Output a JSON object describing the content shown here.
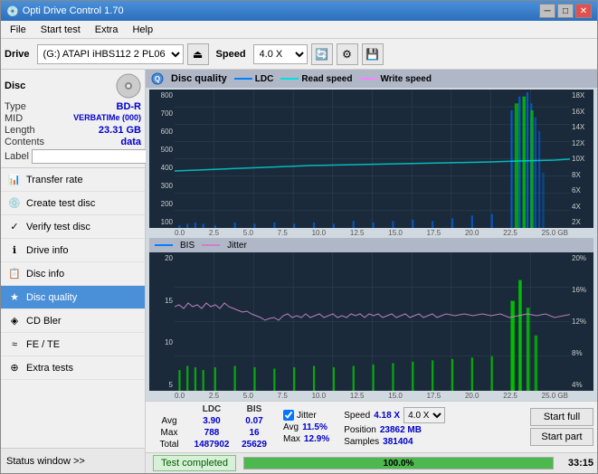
{
  "window": {
    "title": "Opti Drive Control 1.70",
    "minimize": "─",
    "maximize": "□",
    "close": "✕"
  },
  "menubar": {
    "items": [
      "File",
      "Start test",
      "Extra",
      "Help"
    ]
  },
  "toolbar": {
    "drive_label": "Drive",
    "drive_value": "(G:) ATAPI iHBS112 2 PL06",
    "eject_icon": "⏏",
    "speed_label": "Speed",
    "speed_value": "4.0 X"
  },
  "sidebar": {
    "disc_section": {
      "title": "Disc",
      "type_label": "Type",
      "type_value": "BD-R",
      "mid_label": "MID",
      "mid_value": "VERBATIMe (000)",
      "length_label": "Length",
      "length_value": "23.31 GB",
      "contents_label": "Contents",
      "contents_value": "data",
      "label_label": "Label"
    },
    "nav_items": [
      {
        "id": "transfer-rate",
        "label": "Transfer rate",
        "icon": "📊"
      },
      {
        "id": "create-test-disc",
        "label": "Create test disc",
        "icon": "💿"
      },
      {
        "id": "verify-test-disc",
        "label": "Verify test disc",
        "icon": "✓"
      },
      {
        "id": "drive-info",
        "label": "Drive info",
        "icon": "ℹ"
      },
      {
        "id": "disc-info",
        "label": "Disc info",
        "icon": "📋"
      },
      {
        "id": "disc-quality",
        "label": "Disc quality",
        "icon": "★",
        "active": true
      },
      {
        "id": "cd-bler",
        "label": "CD Bler",
        "icon": "◈"
      },
      {
        "id": "fe-te",
        "label": "FE / TE",
        "icon": "≈"
      },
      {
        "id": "extra-tests",
        "label": "Extra tests",
        "icon": "⊕"
      }
    ],
    "status_window": "Status window >>"
  },
  "chart": {
    "title": "Disc quality",
    "legend": {
      "ldc_label": "LDC",
      "ldc_color": "#0080ff",
      "read_speed_label": "Read speed",
      "read_speed_color": "#00ffff",
      "write_speed_label": "Write speed",
      "write_speed_color": "#ff80ff"
    },
    "upper": {
      "y_max": 800,
      "y_labels": [
        "800",
        "700",
        "600",
        "500",
        "400",
        "300",
        "200",
        "100"
      ],
      "y_right_labels": [
        "18X",
        "16X",
        "14X",
        "12X",
        "10X",
        "8X",
        "6X",
        "4X",
        "2X"
      ],
      "x_labels": [
        "0.0",
        "2.5",
        "5.0",
        "7.5",
        "10.0",
        "12.5",
        "15.0",
        "17.5",
        "20.0",
        "22.5",
        "25.0 GB"
      ]
    },
    "lower": {
      "title": "BIS",
      "jitter_label": "Jitter",
      "y_max": 20,
      "y_labels": [
        "20",
        "15",
        "10",
        "5"
      ],
      "y_right_labels": [
        "20%",
        "16%",
        "12%",
        "8%",
        "4%"
      ],
      "x_labels": [
        "0.0",
        "2.5",
        "5.0",
        "7.5",
        "10.0",
        "12.5",
        "15.0",
        "17.5",
        "20.0",
        "22.5",
        "25.0 GB"
      ]
    }
  },
  "stats": {
    "headers": [
      "",
      "LDC",
      "BIS"
    ],
    "avg_label": "Avg",
    "avg_ldc": "3.90",
    "avg_bis": "0.07",
    "max_label": "Max",
    "max_ldc": "788",
    "max_bis": "16",
    "total_label": "Total",
    "total_ldc": "1487902",
    "total_bis": "25629",
    "jitter_checked": true,
    "jitter_label": "Jitter",
    "jitter_avg": "11.5%",
    "jitter_max": "12.9%",
    "speed_label": "Speed",
    "speed_value": "4.18 X",
    "speed_select": "4.0 X",
    "position_label": "Position",
    "position_value": "23862 MB",
    "samples_label": "Samples",
    "samples_value": "381404",
    "btn_start_full": "Start full",
    "btn_start_part": "Start part"
  },
  "progress": {
    "percent": 100,
    "percent_text": "100.0%",
    "time": "33:15"
  },
  "status": {
    "text": "Test completed"
  }
}
